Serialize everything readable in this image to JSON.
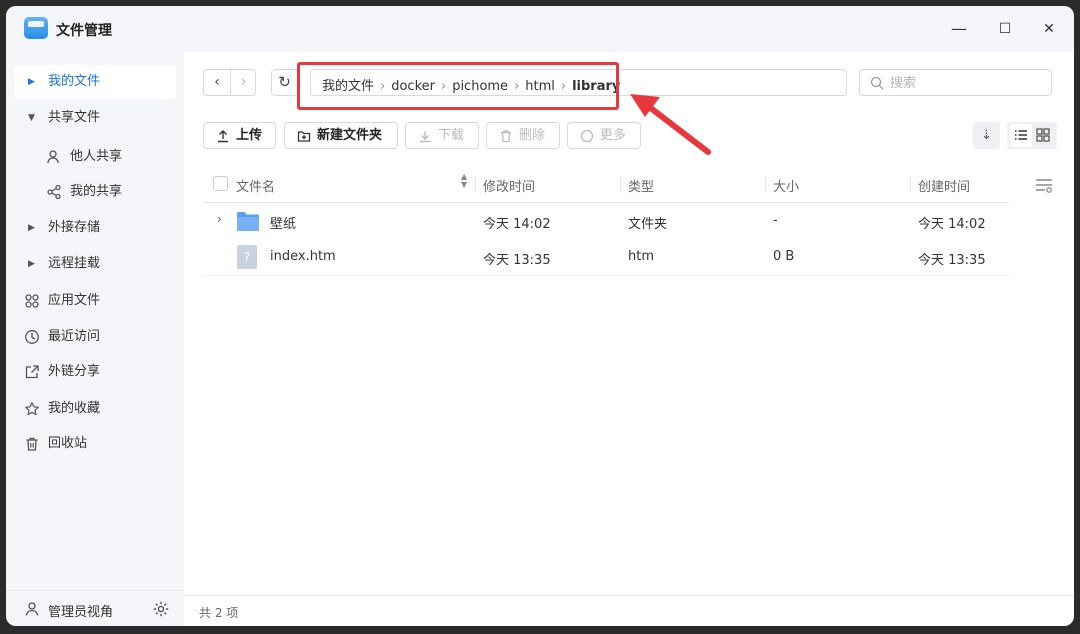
{
  "app": {
    "title": "文件管理"
  },
  "window_controls": {
    "minimize": "—",
    "maximize": "☐",
    "close": "✕"
  },
  "sidebar": {
    "items": [
      {
        "label": "我的文件",
        "active": true
      },
      {
        "label": "共享文件"
      },
      {
        "label": "他人共享"
      },
      {
        "label": "我的共享"
      },
      {
        "label": "外接存储"
      },
      {
        "label": "远程挂载"
      },
      {
        "label": "应用文件"
      },
      {
        "label": "最近访问"
      },
      {
        "label": "外链分享"
      },
      {
        "label": "我的收藏"
      },
      {
        "label": "回收站"
      }
    ],
    "bottom_label": "管理员视角"
  },
  "path": {
    "crumbs": [
      "我的文件",
      "docker",
      "pichome",
      "html",
      "library"
    ],
    "separator": "›"
  },
  "search": {
    "placeholder": "搜索"
  },
  "toolbar": {
    "upload": "上传",
    "new_folder": "新建文件夹",
    "download": "下载",
    "delete": "删除",
    "more": "更多"
  },
  "table": {
    "headers": {
      "name": "文件名",
      "modified": "修改时间",
      "type": "类型",
      "size": "大小",
      "created": "创建时间"
    },
    "rows": [
      {
        "name": "壁纸",
        "modified": "今天 14:02",
        "type": "文件夹",
        "size": "-",
        "created": "今天 14:02"
      },
      {
        "name": "index.htm",
        "modified": "今天 13:35",
        "type": "htm",
        "size": "0 B",
        "created": "今天 13:35"
      }
    ]
  },
  "status": {
    "count": "共 2 项"
  },
  "colors": {
    "accent": "#1a73e8",
    "highlight": "#e8383d",
    "folder": "#5b9ef0"
  },
  "icons": [
    "app-icon",
    "back-icon",
    "forward-icon",
    "refresh-icon",
    "search-icon",
    "upload-icon",
    "new-folder-icon",
    "download-icon",
    "delete-icon",
    "more-icon",
    "sort-icon",
    "list-view-icon",
    "grid-view-icon",
    "column-settings-icon",
    "folder-icon",
    "file-unknown-icon",
    "gear-icon",
    "user-icon",
    "share-icon",
    "apps-icon",
    "clock-icon",
    "link-share-icon",
    "star-icon",
    "trash-icon"
  ]
}
